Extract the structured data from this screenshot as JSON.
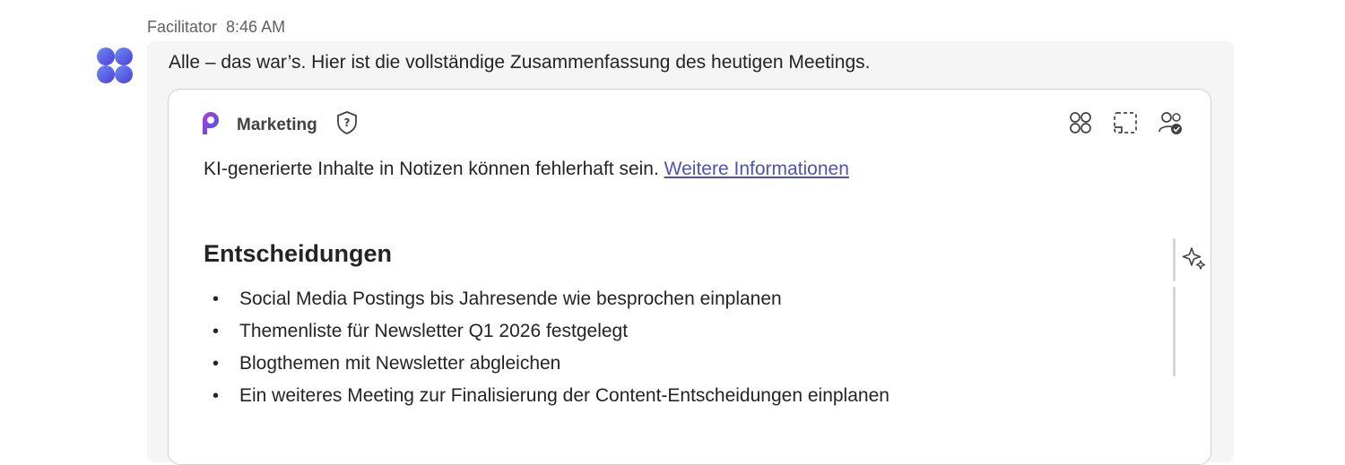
{
  "message": {
    "sender": "Facilitator",
    "time": "8:46 AM",
    "text": "Alle – das war’s. Hier ist die vollständige Zusammenfassung des heutigen Meetings."
  },
  "card": {
    "title": "Marketing",
    "disclaimer_text": "KI-generierte Inhalte in Notizen können fehlerhaft sein.",
    "disclaimer_link": "Weitere Informationen",
    "section_heading": "Entscheidungen",
    "items": [
      "Social Media Postings bis Jahresende wie besprochen einplanen",
      "Themenliste für Newsletter Q1 2026 festgelegt",
      "Blogthemen mit Newsletter abgleichen",
      "Ein weiteres Meeting zur Finalisierung der Content-Entscheidungen einplanen"
    ],
    "bullet": "•"
  },
  "icons": {
    "avatar": "copilot-avatar-icon",
    "app": "loop-app-icon",
    "help": "shield-question-icon",
    "apps": "apps-grid-icon",
    "select": "dashed-select-icon",
    "people": "people-check-icon",
    "sparkle": "sparkle-icon"
  },
  "colors": {
    "link": "#4f52b2",
    "bubble_bg": "#f5f5f5",
    "avatar_primary": "#5b5fe8"
  }
}
